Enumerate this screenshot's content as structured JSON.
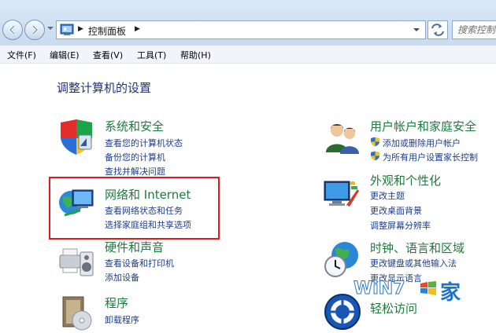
{
  "address_bar": {
    "breadcrumb": "控制面板",
    "search_placeholder": "搜索控制面"
  },
  "menubar": {
    "items": [
      "文件(F)",
      "编辑(E)",
      "查看(V)",
      "工具(T)",
      "帮助(H)"
    ]
  },
  "page": {
    "title": "调整计算机的设置"
  },
  "categories": [
    {
      "title": "系统和安全",
      "links": [
        "查看您的计算机状态",
        "备份您的计算机",
        "查找并解决问题"
      ],
      "icon": "system-security-icon"
    },
    {
      "title": "网络和 Internet",
      "links": [
        "查看网络状态和任务",
        "选择家庭组和共享选项"
      ],
      "icon": "network-internet-icon",
      "highlighted": true
    },
    {
      "title": "硬件和声音",
      "links": [
        "查看设备和打印机",
        "添加设备"
      ],
      "icon": "hardware-sound-icon"
    },
    {
      "title": "程序",
      "links": [
        "卸载程序"
      ],
      "icon": "programs-icon"
    },
    {
      "title": "用户帐户和家庭安全",
      "links": [
        "添加或删除用户帐户",
        "为所有用户设置家长控制"
      ],
      "icon": "user-accounts-icon",
      "shielded_links": true
    },
    {
      "title": "外观和个性化",
      "links": [
        "更改主题",
        "更改桌面背景",
        "调整屏幕分辨率"
      ],
      "icon": "appearance-icon"
    },
    {
      "title": "时钟、语言和区域",
      "links": [
        "更改键盘或其他输入法",
        "更改显示语言"
      ],
      "icon": "clock-region-icon"
    },
    {
      "title": "轻松访问",
      "links": [],
      "icon": "ease-of-access-icon"
    }
  ],
  "watermark": {
    "text": "WiN7",
    "char": "家"
  },
  "colors": {
    "title_blue": "#1e3287",
    "category_green": "#1d7a3d",
    "link_blue": "#1c3e86",
    "highlight_red": "#e0191d"
  }
}
